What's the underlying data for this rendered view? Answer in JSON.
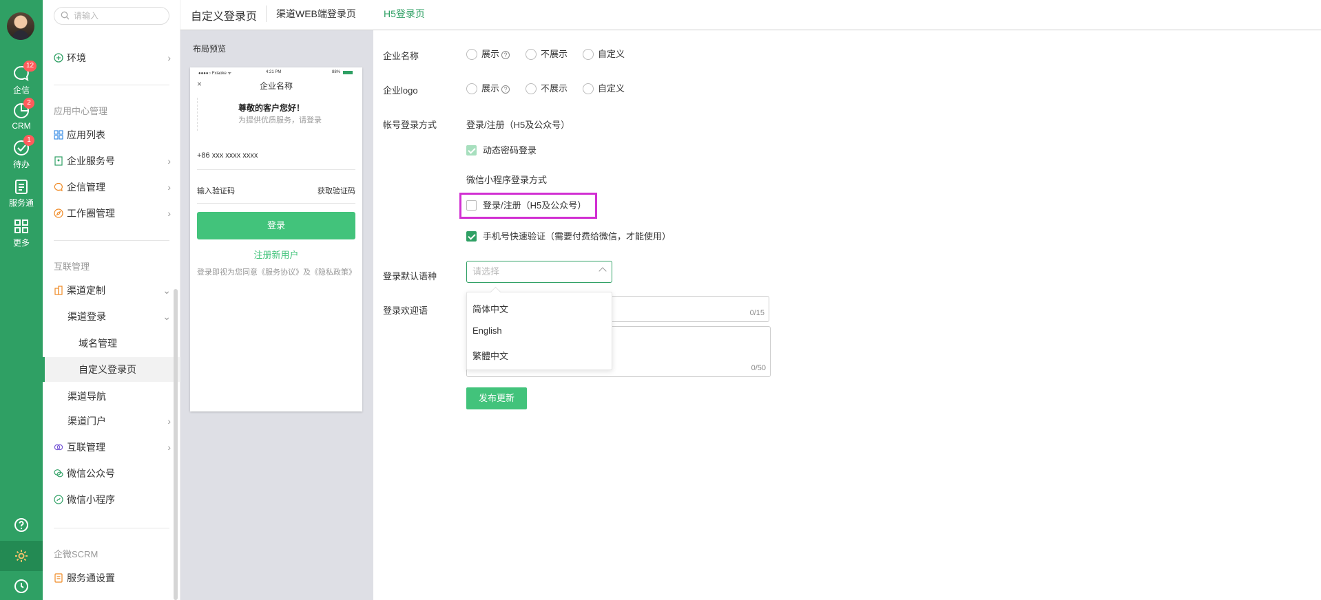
{
  "rail": {
    "items": [
      {
        "label": "企信",
        "badge": "12"
      },
      {
        "label": "CRM",
        "badge": "2"
      },
      {
        "label": "待办",
        "badge": "1"
      },
      {
        "label": "服务通",
        "badge": ""
      },
      {
        "label": "更多",
        "badge": ""
      }
    ]
  },
  "menu": {
    "search_placeholder": "请输入",
    "env": "环境",
    "group_app": "应用中心管理",
    "app_list": "应用列表",
    "enterprise_service": "企业服务号",
    "qixin_manage": "企信管理",
    "workcircle_manage": "工作圈管理",
    "group_interconnect": "互联管理",
    "channel_custom": "渠道定制",
    "channel_login": "渠道登录",
    "domain_manage": "域名管理",
    "custom_login_page": "自定义登录页",
    "channel_nav": "渠道导航",
    "channel_portal": "渠道门户",
    "interconnect_manage": "互联管理",
    "wechat_official": "微信公众号",
    "wechat_mini": "微信小程序",
    "group_scrm": "企微SCRM",
    "service_settings": "服务通设置"
  },
  "tabs": {
    "title": "自定义登录页",
    "web": "渠道WEB端登录页",
    "h5": "H5登录页"
  },
  "preview": {
    "label": "布局预览",
    "carrier": "●●●●○ Fxiaoke ᯤ",
    "time": "4:21 PM",
    "battery": "88%",
    "close": "×",
    "company_name": "企业名称",
    "welcome": "尊敬的客户您好！",
    "welcome_sub": "为提供优质服务，请登录",
    "phone_placeholder": "+86 xxx xxxx xxxx",
    "code_placeholder": "输入验证码",
    "get_code": "获取验证码",
    "login_button": "登录",
    "register": "注册新用户",
    "agreement": "登录即视为您同意《服务协议》及《隐私政策》"
  },
  "form": {
    "company_name_label": "企业名称",
    "company_logo_label": "企业logo",
    "opt_show": "展示",
    "opt_hide": "不展示",
    "opt_custom": "自定义",
    "account_login_label": "帐号登录方式",
    "account_login_value": "登录/注册（H5及公众号）",
    "dynamic_pwd": "动态密码登录",
    "wechat_mini_label": "微信小程序登录方式",
    "wechat_login_register": "登录/注册（H5及公众号）",
    "phone_quick": "手机号快速验证（需要付费给微信，才能使用）",
    "default_lang_label": "登录默认语种",
    "select_placeholder": "请选择",
    "lang_options": [
      "简体中文",
      "English",
      "繁體中文"
    ],
    "welcome_label": "登录欢迎语",
    "counter1": "0/15",
    "counter2": "0/50",
    "publish": "发布更新"
  },
  "colors": {
    "brand": "#2fa064",
    "highlight": "#d12fd2"
  }
}
